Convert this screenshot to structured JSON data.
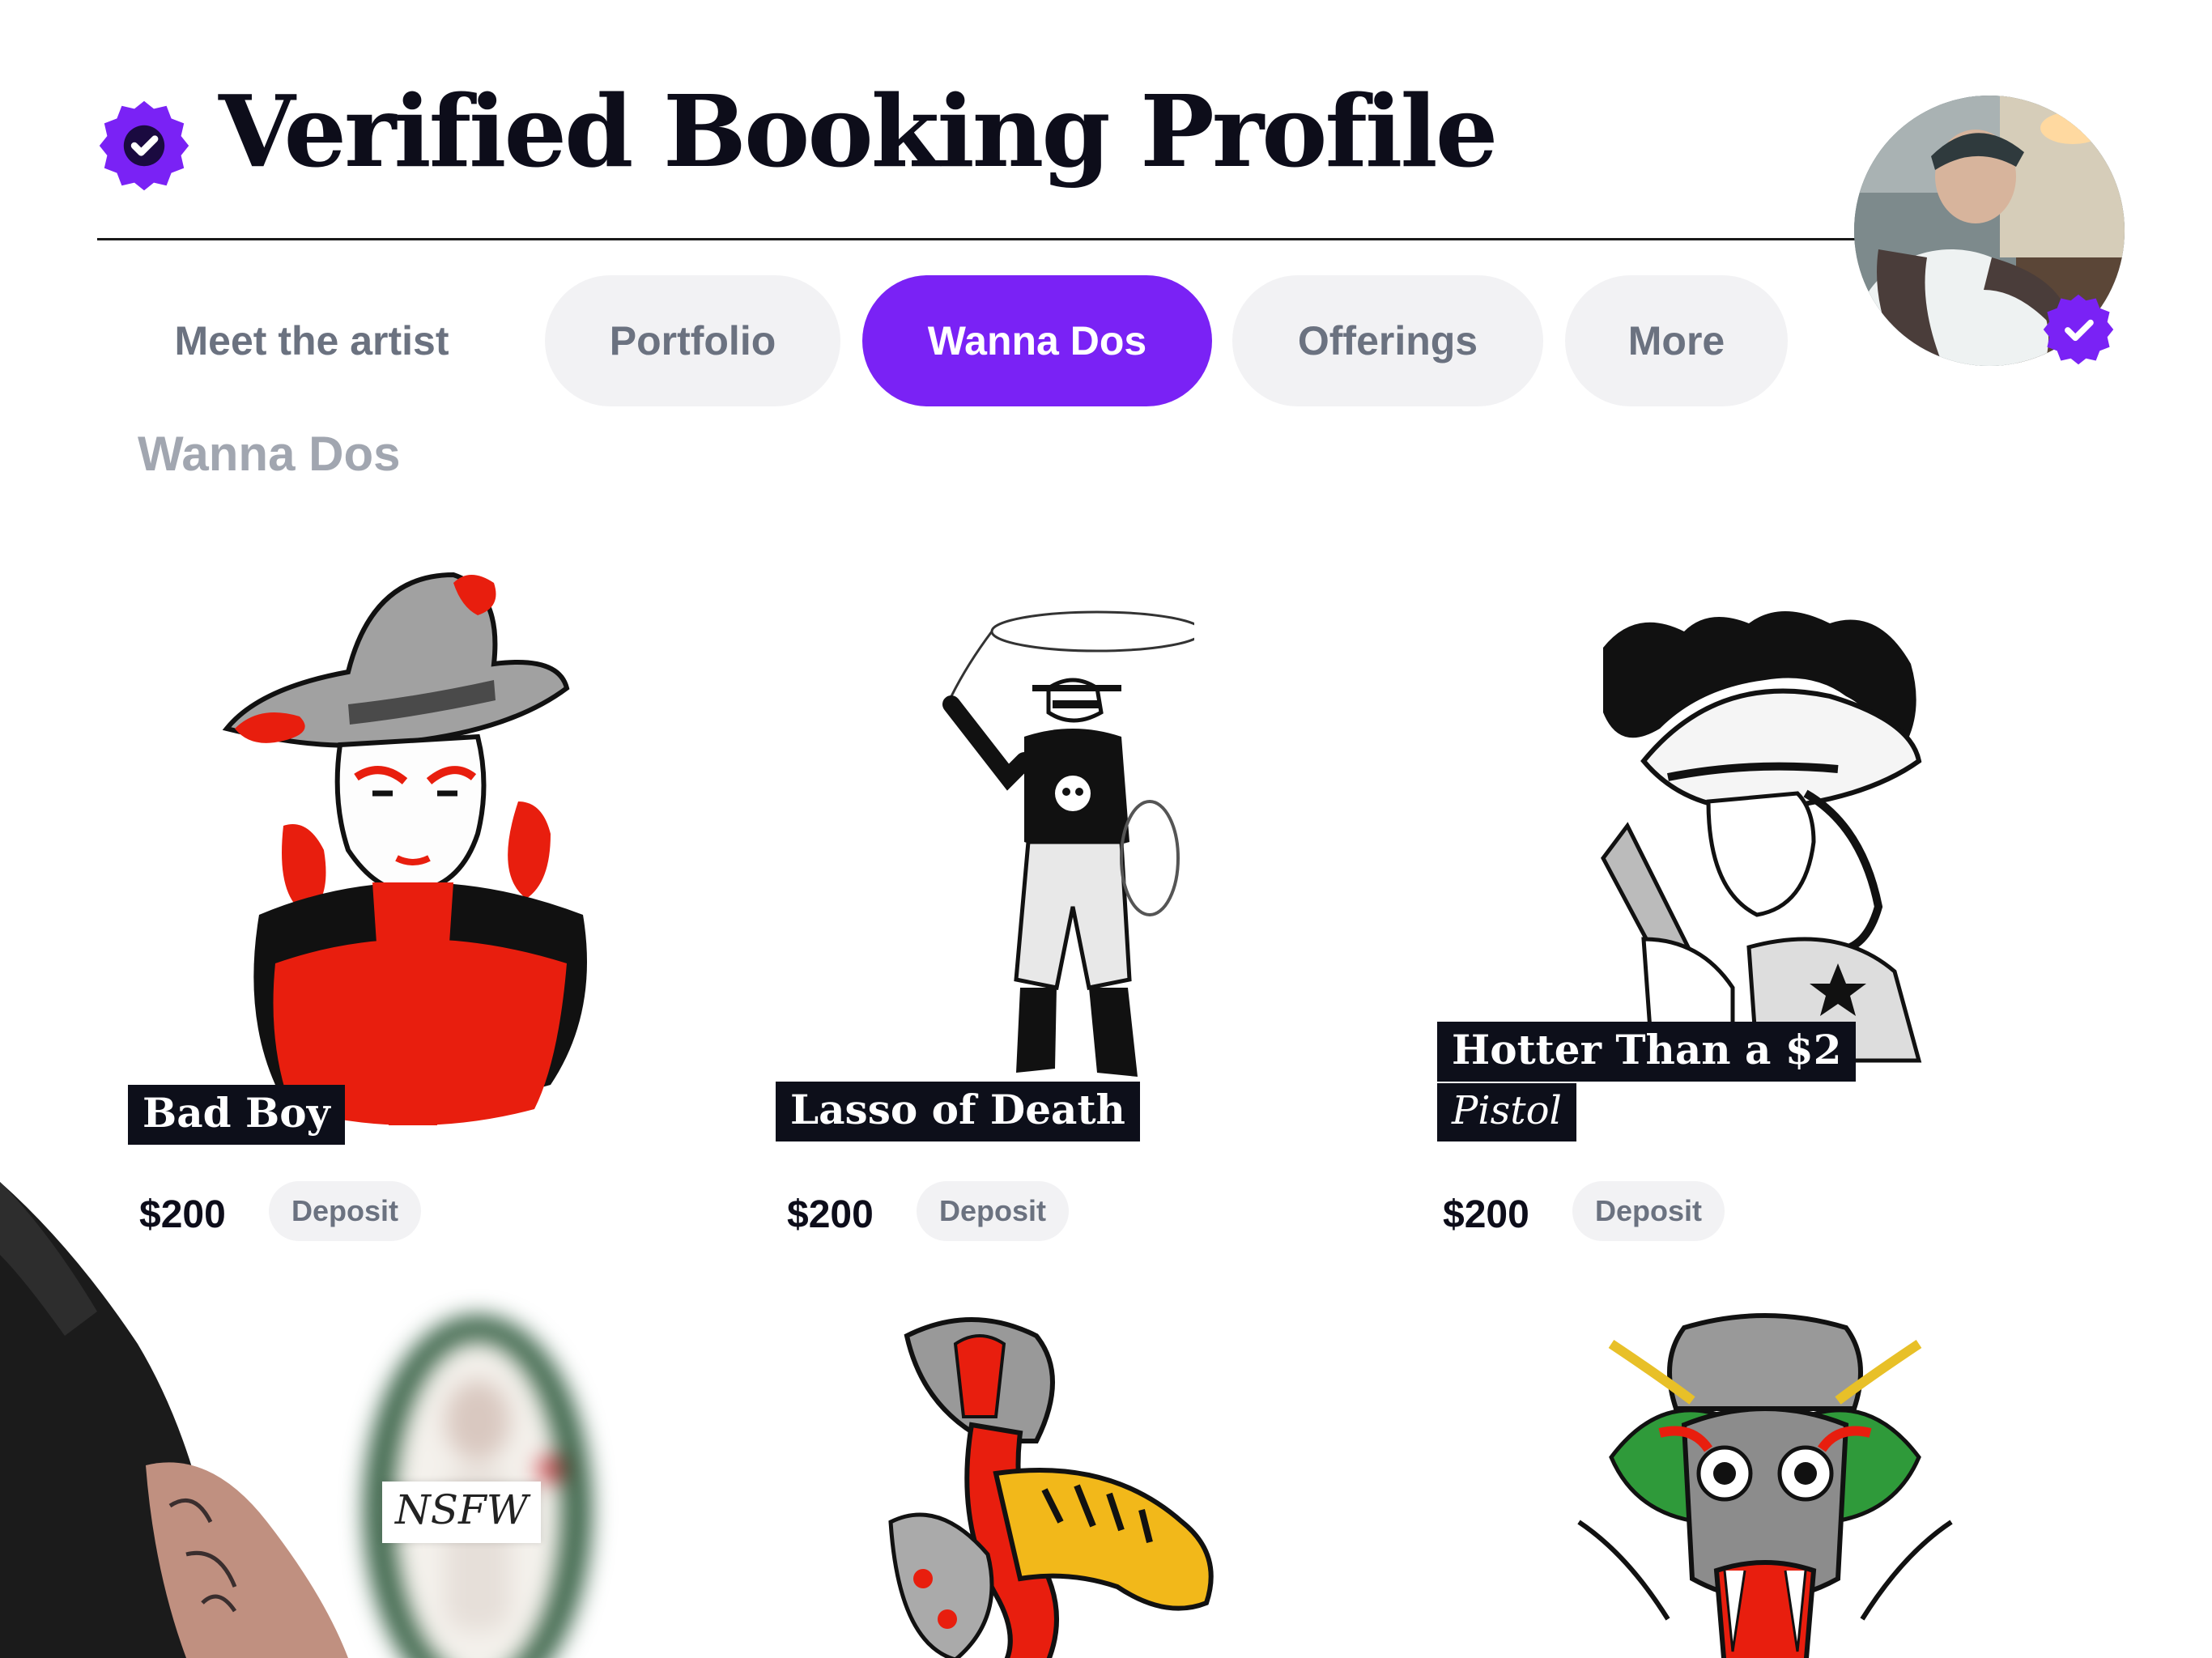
{
  "header": {
    "title": "Verified Booking Profile"
  },
  "tabs": [
    {
      "label": "Meet the artist",
      "state": "plain"
    },
    {
      "label": "Portfolio",
      "state": "pill"
    },
    {
      "label": "Wanna Dos",
      "state": "active"
    },
    {
      "label": "Offerings",
      "state": "pill"
    },
    {
      "label": "More",
      "state": "pill"
    }
  ],
  "section": {
    "title": "Wanna Dos"
  },
  "cards": [
    {
      "name": "Bad Boy",
      "price": "$200",
      "price_note": "Deposit",
      "icon": "cowboy-devils-tattoo"
    },
    {
      "name": "Lasso of Death",
      "price": "$200",
      "price_note": "Deposit",
      "icon": "cowboy-lasso-skull-tattoo"
    },
    {
      "name": "Hotter Than a $2",
      "subtitle": "Pistol",
      "price": "$200",
      "price_note": "Deposit",
      "icon": "cowgirl-pistol-tattoo"
    },
    {
      "label": "NSFW",
      "icon": "blurred-nsfw-tattoo"
    },
    {
      "icon": "cobra-tiger-tattoo"
    },
    {
      "icon": "dragon-mask-tattoo"
    }
  ],
  "colors": {
    "accent": "#7a22f5",
    "tab_bg": "#f2f2f4",
    "tab_text": "#6b7280",
    "title_text": "#0d0d1a",
    "tag_bg": "#0d0f1a"
  }
}
